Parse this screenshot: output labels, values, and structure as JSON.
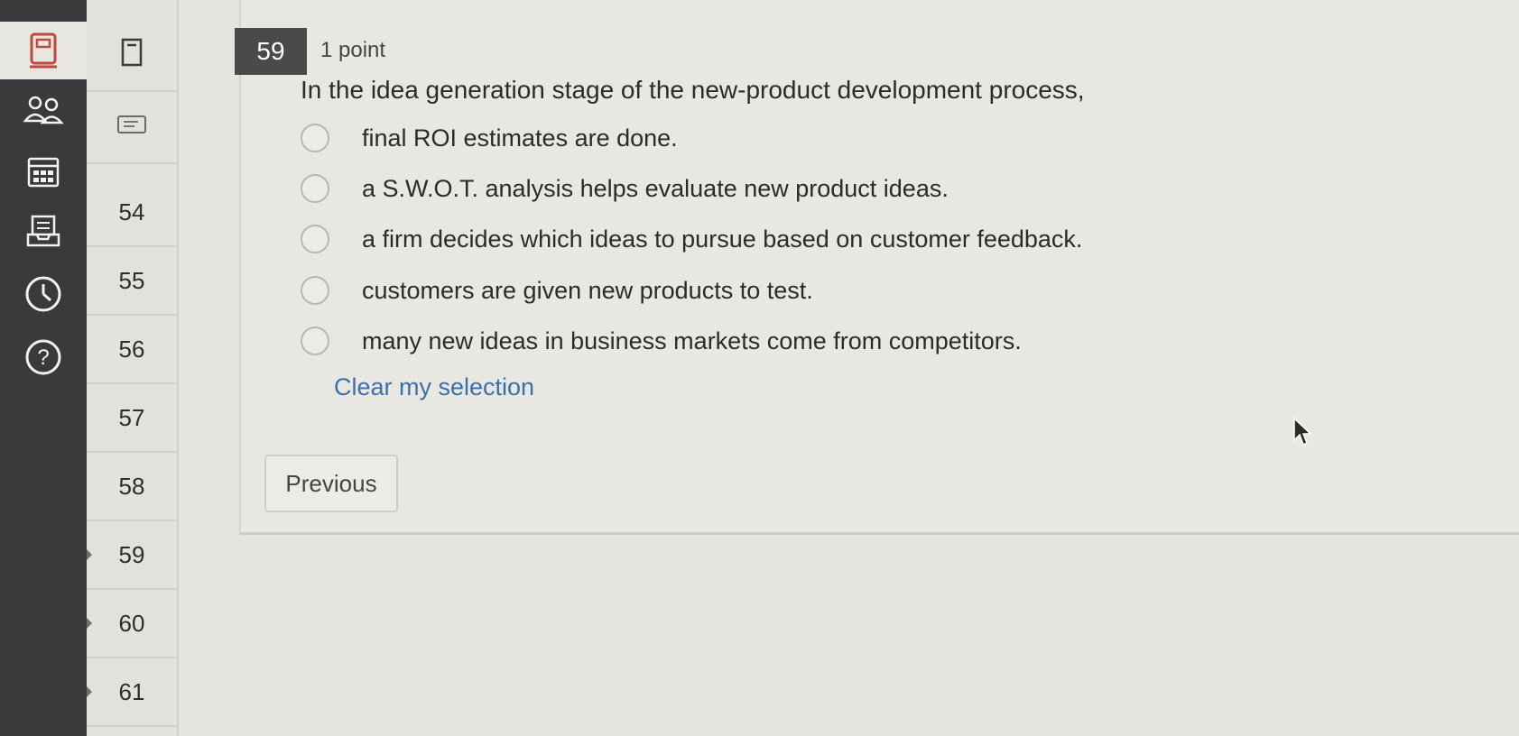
{
  "rail": {
    "items": [
      {
        "icon": "book-icon",
        "active": true
      },
      {
        "icon": "people-icon",
        "active": false
      },
      {
        "icon": "calendar-icon",
        "active": false
      },
      {
        "icon": "inbox-icon",
        "active": false
      },
      {
        "icon": "clock-icon",
        "active": false
      },
      {
        "icon": "help-icon",
        "active": false
      }
    ]
  },
  "navigator": {
    "icons": [
      "flag-icon",
      "note-icon"
    ],
    "numbers": [
      "54",
      "55",
      "56",
      "57",
      "58",
      "59",
      "60",
      "61"
    ]
  },
  "question": {
    "number": "59",
    "points": "1 point",
    "text": "In the idea generation stage of the new-product development process,",
    "options": [
      "final ROI estimates are done.",
      "a S.W.O.T. analysis helps evaluate new product ideas.",
      "a firm decides which ideas to pursue based on customer feedback.",
      "customers are given new products to test.",
      "many new ideas in business markets come from competitors."
    ],
    "clear_label": "Clear my selection"
  },
  "footer": {
    "previous_label": "Previous"
  },
  "colors": {
    "rail_bg": "#3a3a3c",
    "link": "#3b6fa8",
    "qnum_bg": "#4a4a4a"
  }
}
